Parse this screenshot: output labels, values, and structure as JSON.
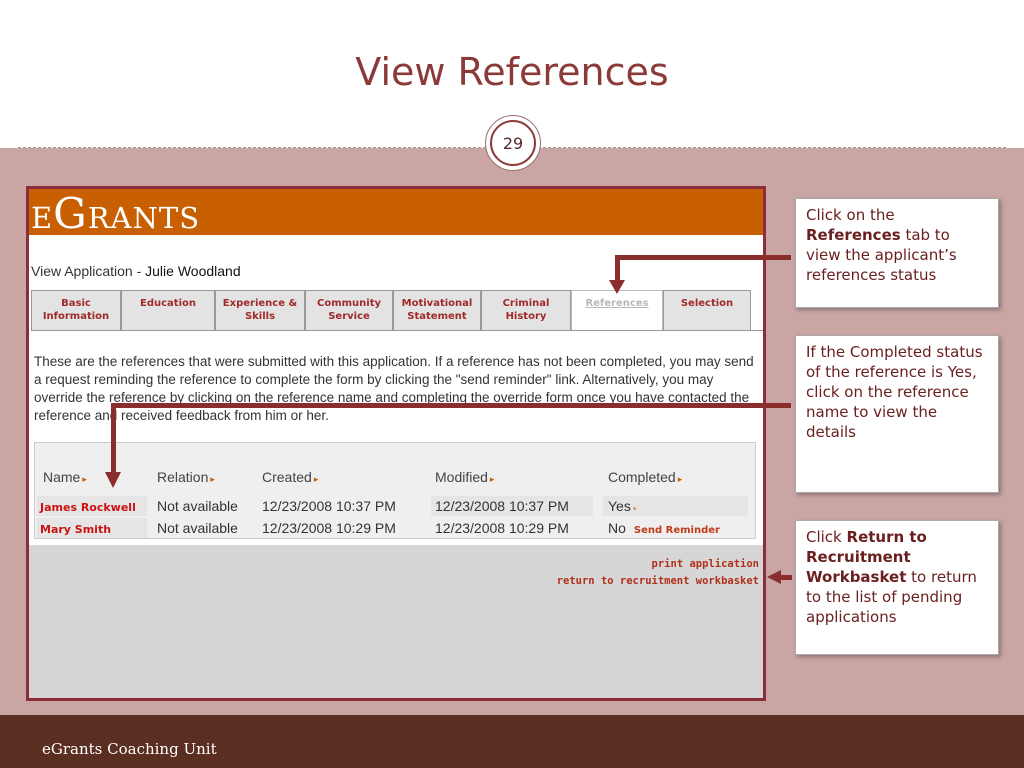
{
  "slide": {
    "title": "View References",
    "page_number": "29",
    "footer": "eGrants Coaching Unit"
  },
  "app": {
    "logo": "eGrants",
    "heading_label": "View Application - ",
    "heading_name": "Julie Woodland",
    "tabs": [
      {
        "label": "Basic Information",
        "active": false
      },
      {
        "label": "Education",
        "active": false
      },
      {
        "label": "Experience & Skills",
        "active": false
      },
      {
        "label": "Community Service",
        "active": false
      },
      {
        "label": "Motivational Statement",
        "active": false
      },
      {
        "label": "Criminal History",
        "active": false
      },
      {
        "label": "References",
        "active": true
      },
      {
        "label": "Selection",
        "active": false
      }
    ],
    "intro": "These are the references that were submitted with this application. If a reference has not been completed, you may send a request reminding the reference to complete the form by clicking the \"send reminder\" link. Alternatively, you may override the reference by clicking on the reference name and completing the override form once you have contacted the reference and received feedback from him or her.",
    "table": {
      "headers": [
        "Name",
        "Relation",
        "Created",
        "Modified",
        "Completed"
      ],
      "rows": [
        {
          "name": "James Rockwell",
          "relation": "Not available",
          "created": "12/23/2008 10:37 PM",
          "modified": "12/23/2008 10:37 PM",
          "completed": "Yes",
          "action": ""
        },
        {
          "name": "Mary Smith",
          "relation": "Not available",
          "created": "12/23/2008 10:29 PM",
          "modified": "12/23/2008 10:29 PM",
          "completed": "No",
          "action": "Send Reminder"
        }
      ]
    },
    "links": {
      "print": "print application",
      "return": "return to recruitment workbasket"
    }
  },
  "callouts": {
    "c1": {
      "pre": "Click on the ",
      "bold": "References",
      "post": " tab to view the applicant’s references status"
    },
    "c2": {
      "text": "If the Completed status of the reference is Yes, click on the reference name to view the details"
    },
    "c3": {
      "pre": "Click ",
      "bold": "Return to Recruitment Workbasket",
      "post": " to return to the list of pending applications"
    }
  },
  "colors": {
    "accent": "#8b2d2d",
    "banner": "#c85f00",
    "band": "#c9a5a4",
    "footer": "#5b2e22"
  }
}
